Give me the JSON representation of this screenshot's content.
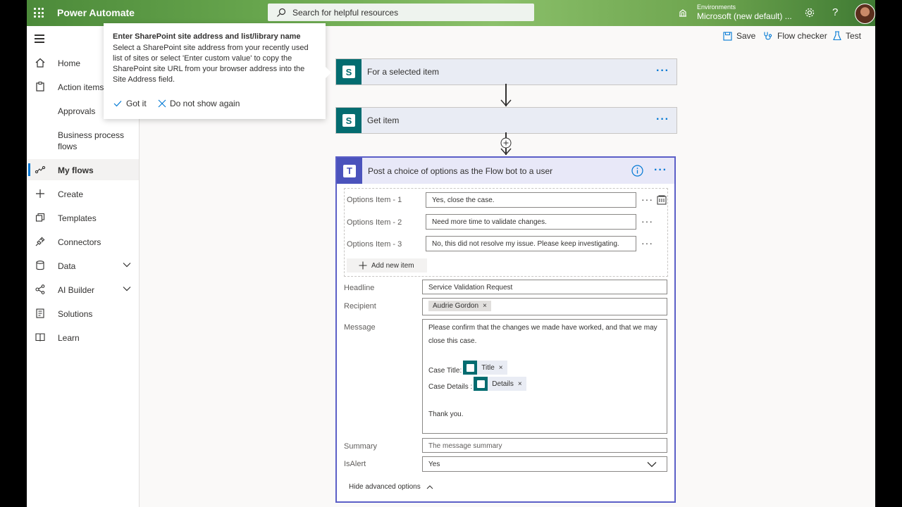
{
  "header": {
    "app_name": "Power Automate",
    "search_placeholder": "Search for helpful resources",
    "environment_label": "Environments",
    "environment_value": "Microsoft (new default) ...",
    "help_glyph": "?"
  },
  "sidebar": {
    "items": [
      {
        "label": "Home"
      },
      {
        "label": "Action items"
      },
      {
        "label": "Approvals"
      },
      {
        "label": "Business process flows"
      },
      {
        "label": "My flows"
      },
      {
        "label": "Create"
      },
      {
        "label": "Templates"
      },
      {
        "label": "Connectors"
      },
      {
        "label": "Data"
      },
      {
        "label": "AI Builder"
      },
      {
        "label": "Solutions"
      },
      {
        "label": "Learn"
      }
    ]
  },
  "toolbar": {
    "save_label": "Save",
    "flow_checker_label": "Flow checker",
    "test_label": "Test"
  },
  "tip": {
    "title": "Enter SharePoint site address and list/library name",
    "body": "Select a SharePoint site address from your recently used list of sites or select 'Enter custom value' to copy the SharePoint site URL from your browser address into the Site Address field.",
    "got_it": "Got it",
    "do_not_show": "Do not show again"
  },
  "flow": {
    "trigger": {
      "title": "For a selected item",
      "more": "···"
    },
    "get_item": {
      "title": "Get item",
      "more": "···"
    },
    "teams_action": {
      "title": "Post a choice of options as the Flow bot to a user",
      "more": "···",
      "options": [
        {
          "label": "Options Item - 1",
          "value": "Yes, close the case."
        },
        {
          "label": "Options Item - 2",
          "value": "Need more time to validate changes."
        },
        {
          "label": "Options Item - 3",
          "value": "No, this did not resolve my issue. Please keep investigating."
        }
      ],
      "add_new_item": "Add new item",
      "headline_label": "Headline",
      "headline_value": "Service Validation Request",
      "recipient_label": "Recipient",
      "recipient_token": "Audrie Gordon",
      "message_label": "Message",
      "message_line1": "Please confirm that the changes we made have worked, and that we may",
      "message_line2": "close this case.",
      "case_title_label": "Case Title:",
      "case_title_token": "Title",
      "case_details_label": "Case Details :",
      "case_details_token": "Details",
      "message_closing": "Thank you.",
      "summary_label": "Summary",
      "summary_placeholder": "The message summary",
      "isalert_label": "IsAlert",
      "isalert_value": "Yes",
      "hide_advanced": "Hide advanced options",
      "remove_glyph": "×"
    }
  },
  "colors": {
    "brand_green": "#6aa84f",
    "accent_blue": "#0078d4",
    "sharepoint_teal": "#036c70",
    "teams_purple": "#4b53bc"
  }
}
